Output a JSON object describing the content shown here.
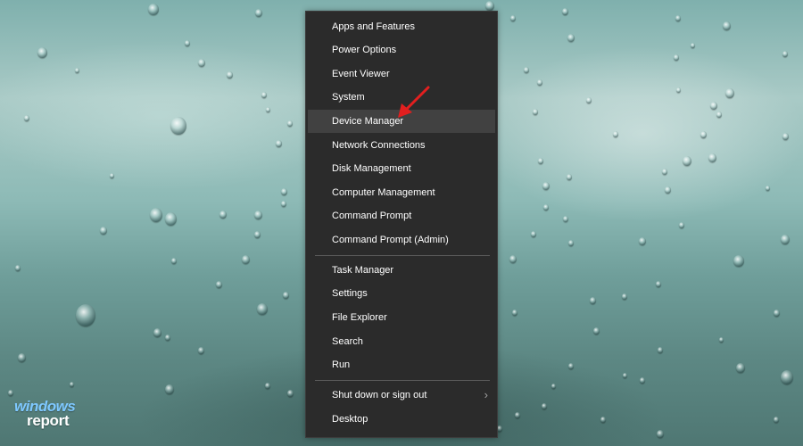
{
  "context_menu": {
    "group1": [
      "Apps and Features",
      "Power Options",
      "Event Viewer",
      "System",
      "Device Manager",
      "Network Connections",
      "Disk Management",
      "Computer Management",
      "Command Prompt",
      "Command Prompt (Admin)"
    ],
    "group2": [
      "Task Manager",
      "Settings",
      "File Explorer",
      "Search",
      "Run"
    ],
    "group3": [
      "Shut down or sign out",
      "Desktop"
    ],
    "hovered_item": "Device Manager",
    "submenu_item": "Shut down or sign out"
  },
  "watermark": {
    "line1": "windows",
    "line2": "report"
  },
  "colors": {
    "menu_bg": "#2b2b2b",
    "hover_bg": "#414141",
    "text": "#ffffff",
    "annotation_arrow": "#e21f1f",
    "logo_blue": "#7ec8ff"
  },
  "icons": {
    "submenu": "chevron-right-icon",
    "annotation": "red-arrow-icon"
  }
}
